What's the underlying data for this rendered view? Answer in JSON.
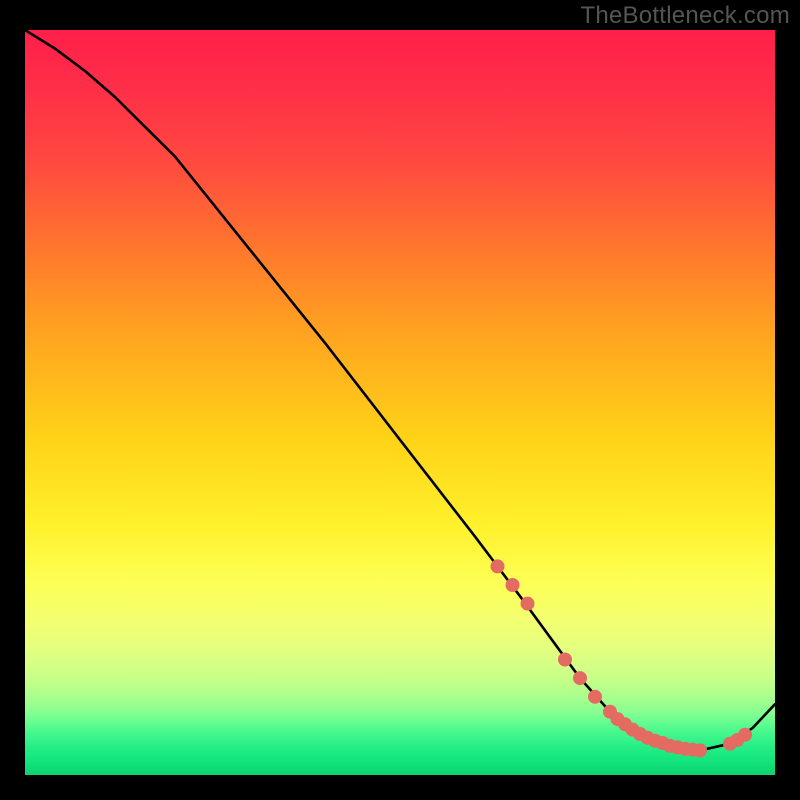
{
  "watermark": "TheBottleneck.com",
  "chart_data": {
    "type": "line",
    "title": "",
    "xlabel": "",
    "ylabel": "",
    "xlim": [
      0,
      100
    ],
    "ylim": [
      0,
      100
    ],
    "grid": false,
    "series": [
      {
        "name": "curve",
        "color": "#000000",
        "x": [
          0,
          4,
          8,
          12,
          20,
          30,
          40,
          50,
          60,
          66,
          70,
          74,
          78,
          82,
          86,
          90,
          94,
          97,
          100
        ],
        "y": [
          100,
          97.5,
          94.5,
          91,
          83,
          70.5,
          58,
          45,
          32,
          24,
          18.5,
          13,
          8.5,
          5.5,
          3.8,
          3.3,
          4.2,
          6.3,
          9.5
        ]
      },
      {
        "name": "markers",
        "color": "#e36b62",
        "type": "scatter",
        "x": [
          63,
          65,
          67,
          72,
          74,
          76,
          78,
          79,
          80,
          81,
          82,
          83,
          84,
          85,
          86,
          87,
          88,
          89,
          90,
          94,
          95,
          96
        ],
        "y": [
          28,
          25.5,
          23,
          15.5,
          13,
          10.5,
          8.5,
          7.5,
          6.8,
          6.1,
          5.5,
          5.0,
          4.6,
          4.3,
          3.9,
          3.7,
          3.5,
          3.4,
          3.3,
          4.2,
          4.7,
          5.4
        ]
      }
    ]
  }
}
